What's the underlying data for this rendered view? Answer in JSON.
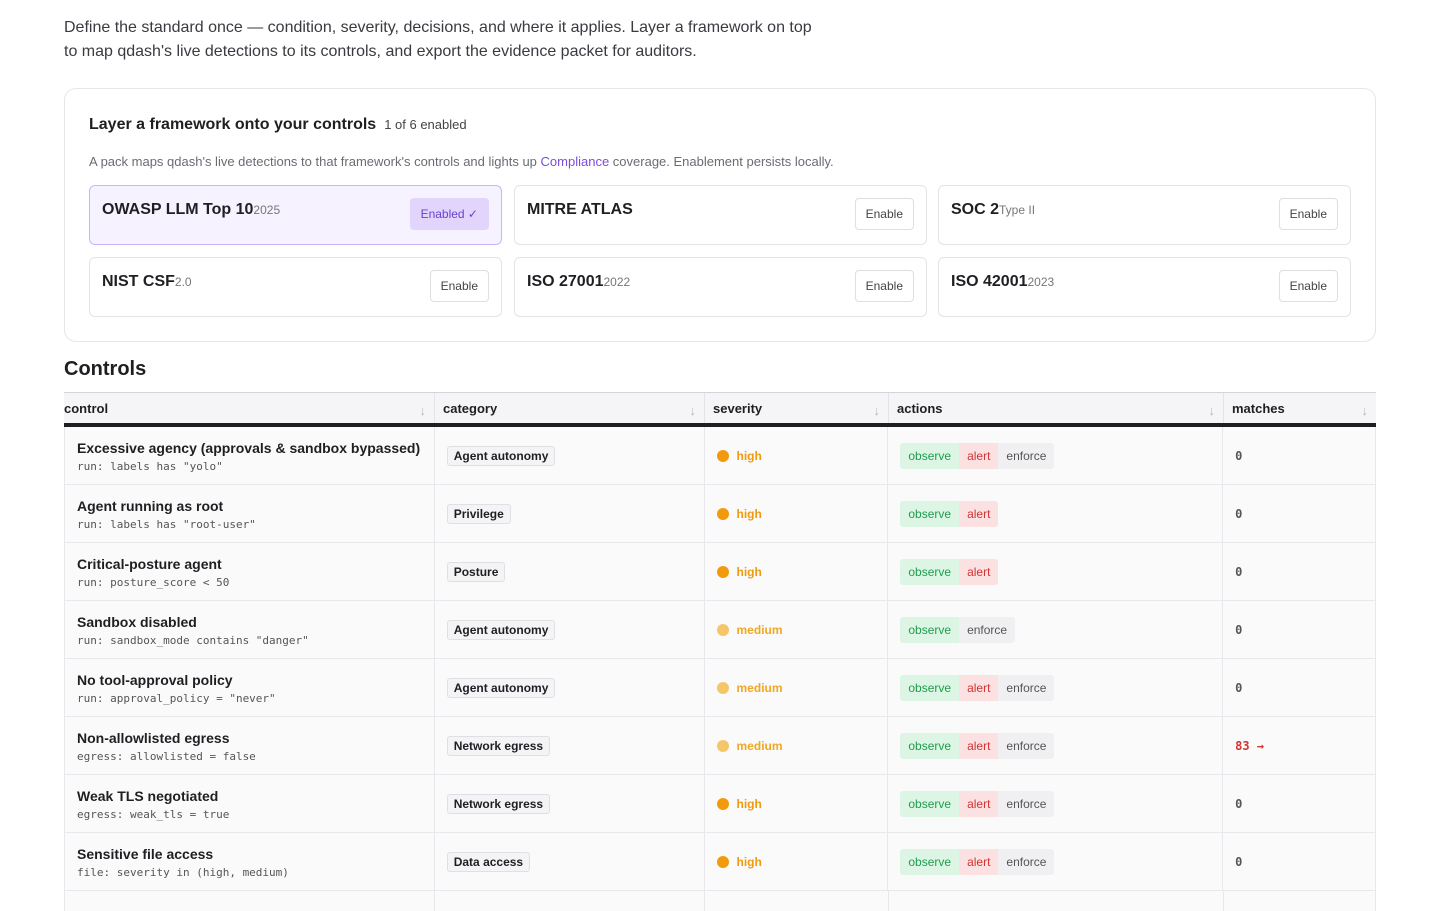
{
  "intro": {
    "line1": "Define the standard once — condition, severity, decisions, and where it applies. Layer a framework on top",
    "line2": "to map qdash's live detections to its controls, and export the evidence packet for auditors."
  },
  "frameworks": {
    "title": "Layer a framework onto your controls",
    "count": "1 of 6 enabled",
    "desc_before": "A pack maps qdash's live detections to that framework's controls and lights up ",
    "desc_link": "Compliance",
    "desc_after": " coverage. Enablement persists locally.",
    "packs": [
      {
        "name": "OWASP LLM Top 10",
        "version": "2025",
        "button": "Enabled ✓",
        "enabled": true
      },
      {
        "name": "MITRE ATLAS",
        "version": "",
        "button": "Enable",
        "enabled": false
      },
      {
        "name": "SOC 2",
        "version": "Type II",
        "button": "Enable",
        "enabled": false
      },
      {
        "name": "NIST CSF",
        "version": "2.0",
        "button": "Enable",
        "enabled": false
      },
      {
        "name": "ISO 27001",
        "version": "2022",
        "button": "Enable",
        "enabled": false
      },
      {
        "name": "ISO 42001",
        "version": "2023",
        "button": "Enable",
        "enabled": false
      }
    ]
  },
  "controls": {
    "title": "Controls",
    "columns": [
      "control",
      "category",
      "severity",
      "actions",
      "matches"
    ],
    "sort_icon": "↓",
    "colors": {
      "high": "#f29a0e",
      "medium": "#f5c56a",
      "medium_text": "#f0a824"
    },
    "rows": [
      {
        "name": "Excessive agency (approvals & sandbox bypassed)",
        "rule": "run: labels has \"yolo\"",
        "category": "Agent autonomy",
        "severity": "high",
        "actions": [
          "observe",
          "alert",
          "enforce"
        ],
        "matches": "0"
      },
      {
        "name": "Agent running as root",
        "rule": "run: labels has \"root-user\"",
        "category": "Privilege",
        "severity": "high",
        "actions": [
          "observe",
          "alert"
        ],
        "matches": "0"
      },
      {
        "name": "Critical-posture agent",
        "rule": "run: posture_score < 50",
        "category": "Posture",
        "severity": "high",
        "actions": [
          "observe",
          "alert"
        ],
        "matches": "0"
      },
      {
        "name": "Sandbox disabled",
        "rule": "run: sandbox_mode contains \"danger\"",
        "category": "Agent autonomy",
        "severity": "medium",
        "actions": [
          "observe",
          "enforce"
        ],
        "matches": "0"
      },
      {
        "name": "No tool-approval policy",
        "rule": "run: approval_policy = \"never\"",
        "category": "Agent autonomy",
        "severity": "medium",
        "actions": [
          "observe",
          "alert",
          "enforce"
        ],
        "matches": "0"
      },
      {
        "name": "Non-allowlisted egress",
        "rule": "egress: allowlisted = false",
        "category": "Network egress",
        "severity": "medium",
        "actions": [
          "observe",
          "alert",
          "enforce"
        ],
        "matches": "83 →"
      },
      {
        "name": "Weak TLS negotiated",
        "rule": "egress: weak_tls = true",
        "category": "Network egress",
        "severity": "high",
        "actions": [
          "observe",
          "alert",
          "enforce"
        ],
        "matches": "0"
      },
      {
        "name": "Sensitive file access",
        "rule": "file: severity in (high, medium)",
        "category": "Data access",
        "severity": "high",
        "actions": [
          "observe",
          "alert",
          "enforce"
        ],
        "matches": "0"
      }
    ]
  }
}
